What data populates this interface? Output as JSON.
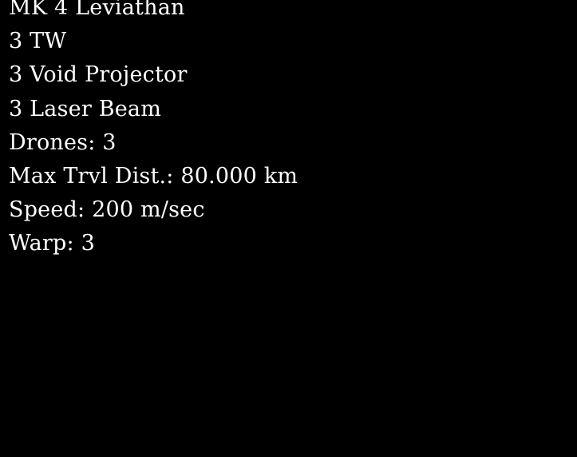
{
  "ship_info": {
    "lines": [
      "MK 4 Leviathan",
      "3 TW",
      "3 Void Projector",
      "3 Laser Beam",
      "Drones: 3",
      "Max Trvl Dist.: 80.000 km",
      "Speed: 200 m/sec",
      "Warp: 3"
    ]
  },
  "colors": {
    "background": "#000000",
    "text": "#ffffff"
  }
}
